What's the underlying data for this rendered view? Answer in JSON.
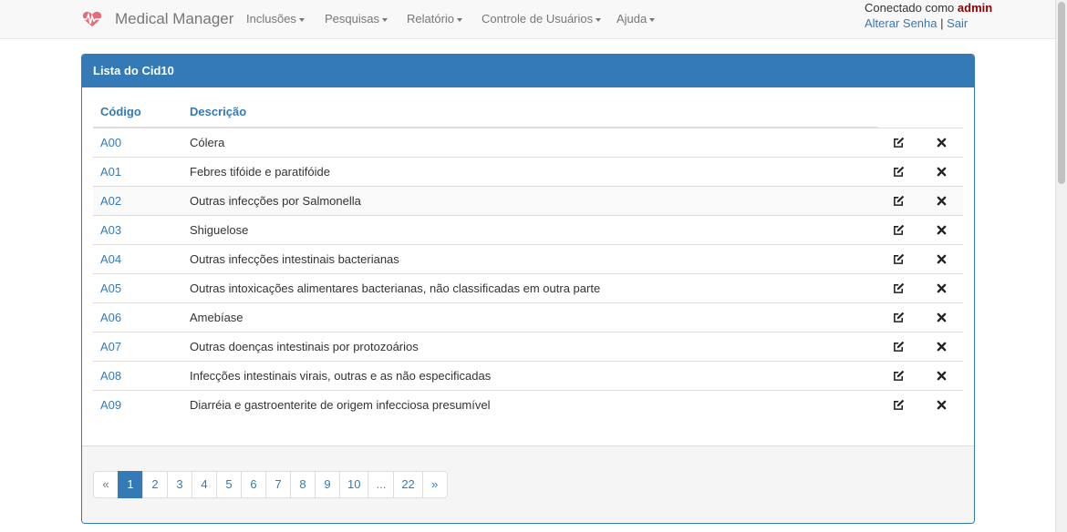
{
  "navbar": {
    "brand": "Medical Manager",
    "menus": [
      {
        "label": "Inclusões"
      },
      {
        "label": "Pesquisas"
      },
      {
        "label": "Relatório"
      },
      {
        "label": "Controle de Usuários"
      },
      {
        "label": "Ajuda"
      }
    ],
    "user": {
      "prefix": "Conectado como ",
      "name": "admin",
      "change_password": "Alterar Senha",
      "separator": "|",
      "logout": "Sair"
    }
  },
  "panel": {
    "title": "Lista do Cid10",
    "columns": {
      "code": "Código",
      "description": "Descrição"
    },
    "rows": [
      {
        "code": "A00",
        "description": "Cólera"
      },
      {
        "code": "A01",
        "description": "Febres tifóide e paratifóide"
      },
      {
        "code": "A02",
        "description": "Outras infecções por Salmonella"
      },
      {
        "code": "A03",
        "description": "Shiguelose"
      },
      {
        "code": "A04",
        "description": "Outras infecções intestinais bacterianas"
      },
      {
        "code": "A05",
        "description": "Outras intoxicações alimentares bacterianas, não classificadas em outra parte"
      },
      {
        "code": "A06",
        "description": "Amebíase"
      },
      {
        "code": "A07",
        "description": "Outras doenças intestinais por protozoários"
      },
      {
        "code": "A08",
        "description": "Infecções intestinais virais, outras e as não especificadas"
      },
      {
        "code": "A09",
        "description": "Diarréia e gastroenterite de origem infecciosa presumível"
      }
    ],
    "row_icons": {
      "edit": "edit-icon",
      "delete": "delete-icon"
    }
  },
  "pagination": {
    "prev": "«",
    "pages": [
      "1",
      "2",
      "3",
      "4",
      "5",
      "6",
      "7",
      "8",
      "9",
      "10",
      "...",
      "22"
    ],
    "next": "»",
    "current": "1"
  },
  "colors": {
    "primary": "#337ab7",
    "admin": "#8b0000",
    "navbar_bg": "#f8f8f8"
  }
}
